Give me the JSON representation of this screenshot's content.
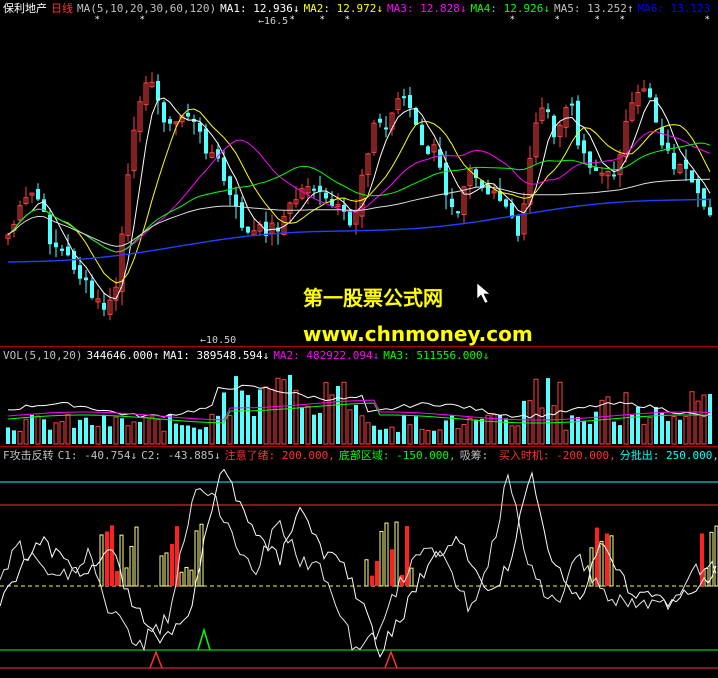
{
  "main": {
    "stock": "保利地产",
    "period": "日线",
    "ma_def": "MA(5,10,20,30,60,120)",
    "ma": [
      {
        "label": "MA1:",
        "value": "12.936↓",
        "color": "#ffffff"
      },
      {
        "label": "MA2:",
        "value": "12.972↓",
        "color": "#ffff00"
      },
      {
        "label": "MA3:",
        "value": "12.828↓",
        "color": "#ff00ff"
      },
      {
        "label": "MA4:",
        "value": "12.926↓",
        "color": "#00ff00"
      },
      {
        "label": "MA5:",
        "value": "13.252↑",
        "color": "#c0c0c0"
      },
      {
        "label": "MA6:",
        "value": "13.123",
        "color": "#0000ff"
      }
    ],
    "high_label": "16.5",
    "low_label": "10.50"
  },
  "vol": {
    "def": "VOL(5,10,20)",
    "value": "344646.000↑",
    "ma": [
      {
        "label": "MA1:",
        "value": "389548.594↓",
        "color": "#ffffff"
      },
      {
        "label": "MA2:",
        "value": "482922.094↓",
        "color": "#ff00ff"
      },
      {
        "label": "MA3:",
        "value": "511556.000↓",
        "color": "#00ff00"
      }
    ]
  },
  "ind": {
    "name": "F攻击反转",
    "items": [
      {
        "label": "C1:",
        "value": "-40.754↓",
        "color": "#c0c0c0"
      },
      {
        "label": "C2:",
        "value": "-43.885↓",
        "color": "#c0c0c0"
      },
      {
        "label": "注意了绪:",
        "value": "200.000,",
        "color": "#ff3030"
      },
      {
        "label": "底部区域:",
        "value": "-150.000,",
        "color": "#00ff00"
      },
      {
        "label": "吸筹:",
        "value": "",
        "color": "#c0c0c0"
      },
      {
        "label": "买入时机:",
        "value": "-200.000,",
        "color": "#ff3030"
      },
      {
        "label": "分批出:",
        "value": "250.000,",
        "color": "#00ffff"
      },
      {
        "label": "牛",
        "value": "",
        "color": "#00ff00"
      }
    ]
  },
  "watermark": {
    "line1": "第一股票公式网",
    "line2": "www.chnmoney.com"
  }
}
